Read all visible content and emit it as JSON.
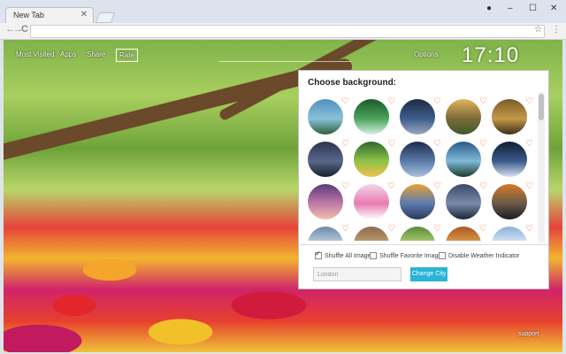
{
  "browser": {
    "tab_title": "New Tab",
    "tab_close": "✕",
    "window_controls": {
      "minimize": "–",
      "maximize": "☐",
      "close": "✕"
    },
    "nav": {
      "back": "←",
      "forward": "→",
      "reload": "C"
    },
    "toolbar_icons": {
      "star": "☆",
      "menu": "⋮",
      "account": "●"
    }
  },
  "page": {
    "nav": {
      "most_visited": "Most Visited",
      "apps": "Apps",
      "share": "Share",
      "rate": "Rate"
    },
    "options": "Options",
    "clock": "17:10",
    "support": "support"
  },
  "popup": {
    "title": "Choose background:",
    "heart_glyph": "♡",
    "thumbnails": [
      {
        "name": "lake-mountain",
        "colors": [
          "#4f8fbf",
          "#89c2d9",
          "#2f5e3a"
        ]
      },
      {
        "name": "waterfall",
        "colors": [
          "#1c5a2a",
          "#4aa35a",
          "#d6efe3"
        ]
      },
      {
        "name": "dark-lake",
        "colors": [
          "#1d2b45",
          "#3e5d8c",
          "#9aa8c0"
        ]
      },
      {
        "name": "sunset-valley",
        "colors": [
          "#e2b45a",
          "#7c6a3a",
          "#3d5b2a"
        ]
      },
      {
        "name": "canyon",
        "colors": [
          "#7a5a2a",
          "#c59a48",
          "#3a2e18"
        ]
      },
      {
        "name": "mountain-dusk",
        "colors": [
          "#2a3450",
          "#59688a",
          "#16202e"
        ]
      },
      {
        "name": "green-hills",
        "colors": [
          "#2c6a2c",
          "#8ec24a",
          "#f0c24a"
        ]
      },
      {
        "name": "night-clouds",
        "colors": [
          "#1b2c4a",
          "#5a7aa8",
          "#a9c0e0"
        ]
      },
      {
        "name": "blue-lake",
        "colors": [
          "#2a5a88",
          "#7fb8d8",
          "#1a3a2a"
        ]
      },
      {
        "name": "tower",
        "colors": [
          "#0f1e36",
          "#3a5a8a",
          "#d8e2f0"
        ]
      },
      {
        "name": "purple-sky",
        "colors": [
          "#5a3a7a",
          "#c07aa8",
          "#f2c0a8"
        ]
      },
      {
        "name": "butterfly",
        "colors": [
          "#f0d8e8",
          "#e87ab0",
          "#ffffff"
        ]
      },
      {
        "name": "sunset-sea",
        "colors": [
          "#e8a23a",
          "#5a7ab0",
          "#2a3a5a"
        ]
      },
      {
        "name": "storm-mountain",
        "colors": [
          "#3a4a6a",
          "#7a8aa8",
          "#1a2436"
        ]
      },
      {
        "name": "lake-sunset",
        "colors": [
          "#d87a2a",
          "#6a5a48",
          "#1a1a22"
        ]
      },
      {
        "name": "rocks",
        "colors": [
          "#6a8aa8",
          "#c8d8e8",
          "#4a5a3a"
        ]
      },
      {
        "name": "cabin",
        "colors": [
          "#8a6a4a",
          "#c8a878",
          "#3a4a2a"
        ]
      },
      {
        "name": "green-field",
        "colors": [
          "#5a8a3a",
          "#b8d87a",
          "#e8f0c8"
        ]
      },
      {
        "name": "forest-path",
        "colors": [
          "#a8582a",
          "#e8a84a",
          "#3a2a1a"
        ]
      },
      {
        "name": "snow-peak",
        "colors": [
          "#8ab0d8",
          "#e8f0f8",
          "#3a5a7a"
        ]
      }
    ],
    "checks": [
      {
        "label": "Shuffle All Images",
        "checked": true
      },
      {
        "label": "Shuffle Favorite Images",
        "checked": false
      },
      {
        "label": "Disable Weather Indicator",
        "checked": false
      }
    ],
    "city_value": "London",
    "change_city": "Change City"
  },
  "colors": {
    "accent": "#2ab3d6",
    "heart": "#f0682a"
  }
}
